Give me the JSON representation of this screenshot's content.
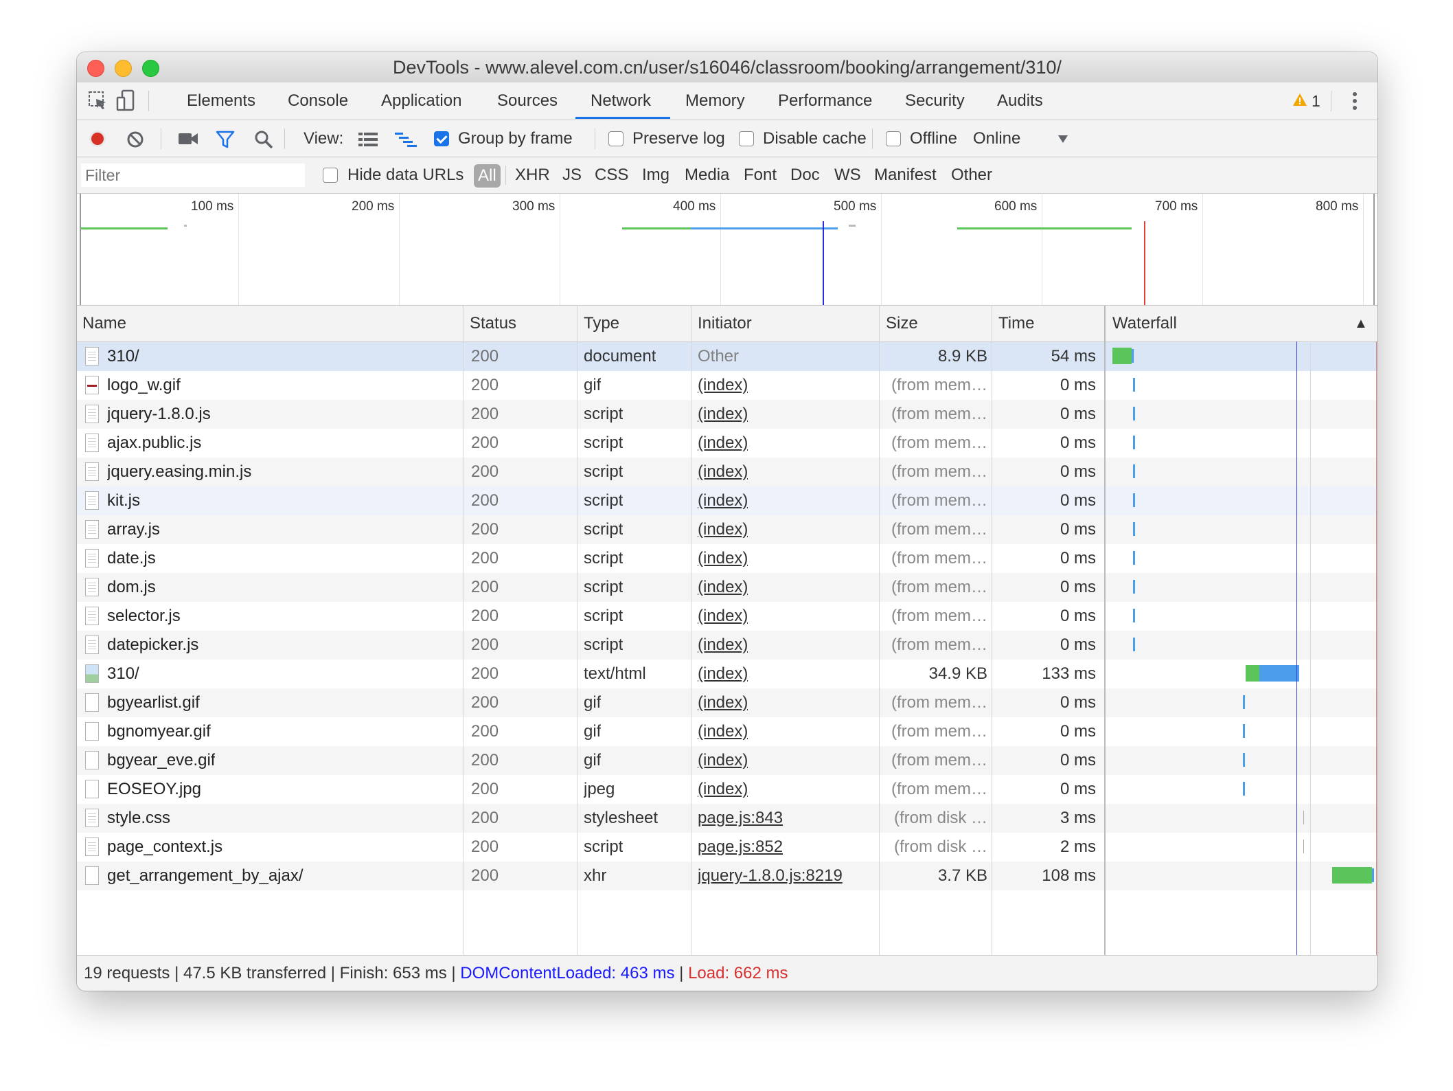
{
  "window": {
    "title": "DevTools - www.alevel.com.cn/user/s16046/classroom/booking/arrangement/310/"
  },
  "tabs": [
    {
      "label": "Elements"
    },
    {
      "label": "Console"
    },
    {
      "label": "Application"
    },
    {
      "label": "Sources"
    },
    {
      "label": "Network"
    },
    {
      "label": "Memory"
    },
    {
      "label": "Performance"
    },
    {
      "label": "Security"
    },
    {
      "label": "Audits"
    }
  ],
  "active_tab": "Network",
  "warnings": {
    "count": "1"
  },
  "toolbar": {
    "view_label": "View:",
    "group_by_frame": "Group by frame",
    "preserve_log": "Preserve log",
    "disable_cache": "Disable cache",
    "offline": "Offline",
    "throttle_value": "Online",
    "group_by_frame_checked": true,
    "preserve_log_checked": false,
    "disable_cache_checked": false,
    "offline_checked": false
  },
  "filter": {
    "placeholder": "Filter",
    "hide_data_urls": "Hide data URLs",
    "types": [
      "All",
      "XHR",
      "JS",
      "CSS",
      "Img",
      "Media",
      "Font",
      "Doc",
      "WS",
      "Manifest",
      "Other"
    ],
    "selected": "All"
  },
  "overview": {
    "ticks": [
      "100 ms",
      "200 ms",
      "300 ms",
      "400 ms",
      "500 ms",
      "600 ms",
      "700 ms",
      "800 ms"
    ],
    "dom_content_loaded_ms": 463,
    "load_ms": 662
  },
  "columns": {
    "name": "Name",
    "status": "Status",
    "type": "Type",
    "initiator": "Initiator",
    "size": "Size",
    "time": "Time",
    "waterfall": "Waterfall",
    "sort_indicator": "▲"
  },
  "requests": [
    {
      "name": "310/",
      "status": "200",
      "type": "document",
      "initiator": "Other",
      "size": "8.9 KB",
      "time": "54 ms",
      "icon": "doc"
    },
    {
      "name": "logo_w.gif",
      "status": "200",
      "type": "gif",
      "initiator": "(index)",
      "size": "(from mem…",
      "time": "0 ms",
      "icon": "gifred"
    },
    {
      "name": "jquery-1.8.0.js",
      "status": "200",
      "type": "script",
      "initiator": "(index)",
      "size": "(from mem…",
      "time": "0 ms",
      "icon": "doc"
    },
    {
      "name": "ajax.public.js",
      "status": "200",
      "type": "script",
      "initiator": "(index)",
      "size": "(from mem…",
      "time": "0 ms",
      "icon": "doc"
    },
    {
      "name": "jquery.easing.min.js",
      "status": "200",
      "type": "script",
      "initiator": "(index)",
      "size": "(from mem…",
      "time": "0 ms",
      "icon": "doc"
    },
    {
      "name": "kit.js",
      "status": "200",
      "type": "script",
      "initiator": "(index)",
      "size": "(from mem…",
      "time": "0 ms",
      "icon": "doc"
    },
    {
      "name": "array.js",
      "status": "200",
      "type": "script",
      "initiator": "(index)",
      "size": "(from mem…",
      "time": "0 ms",
      "icon": "doc"
    },
    {
      "name": "date.js",
      "status": "200",
      "type": "script",
      "initiator": "(index)",
      "size": "(from mem…",
      "time": "0 ms",
      "icon": "doc"
    },
    {
      "name": "dom.js",
      "status": "200",
      "type": "script",
      "initiator": "(index)",
      "size": "(from mem…",
      "time": "0 ms",
      "icon": "doc"
    },
    {
      "name": "selector.js",
      "status": "200",
      "type": "script",
      "initiator": "(index)",
      "size": "(from mem…",
      "time": "0 ms",
      "icon": "doc"
    },
    {
      "name": "datepicker.js",
      "status": "200",
      "type": "script",
      "initiator": "(index)",
      "size": "(from mem…",
      "time": "0 ms",
      "icon": "doc"
    },
    {
      "name": "310/",
      "status": "200",
      "type": "text/html",
      "initiator": "(index)",
      "size": "34.9 KB",
      "time": "133 ms",
      "icon": "img"
    },
    {
      "name": "bgyearlist.gif",
      "status": "200",
      "type": "gif",
      "initiator": "(index)",
      "size": "(from mem…",
      "time": "0 ms",
      "icon": "blank"
    },
    {
      "name": "bgnomyear.gif",
      "status": "200",
      "type": "gif",
      "initiator": "(index)",
      "size": "(from mem…",
      "time": "0 ms",
      "icon": "blank"
    },
    {
      "name": "bgyear_eve.gif",
      "status": "200",
      "type": "gif",
      "initiator": "(index)",
      "size": "(from mem…",
      "time": "0 ms",
      "icon": "blank"
    },
    {
      "name": "EOSEOY.jpg",
      "status": "200",
      "type": "jpeg",
      "initiator": "(index)",
      "size": "(from mem…",
      "time": "0 ms",
      "icon": "blank"
    },
    {
      "name": "style.css",
      "status": "200",
      "type": "stylesheet",
      "initiator": "page.js:843",
      "size": "(from disk …",
      "time": "3 ms",
      "icon": "doc"
    },
    {
      "name": "page_context.js",
      "status": "200",
      "type": "script",
      "initiator": "page.js:852",
      "size": "(from disk …",
      "time": "2 ms",
      "icon": "doc"
    },
    {
      "name": "get_arrangement_by_ajax/",
      "status": "200",
      "type": "xhr",
      "initiator": "jquery-1.8.0.js:8219",
      "size": "3.7 KB",
      "time": "108 ms",
      "icon": "blank"
    }
  ],
  "footer": {
    "summary": "19 requests | 47.5 KB transferred | Finish: 653 ms | ",
    "dcl": "DOMContentLoaded: 463 ms",
    "divider": " | ",
    "load": "Load: 662 ms"
  },
  "colors": {
    "accent": "#1a73e8",
    "waiting": "#5bc55b",
    "download": "#4a9eea",
    "dcl": "#1a1aff",
    "load": "#d63030"
  }
}
